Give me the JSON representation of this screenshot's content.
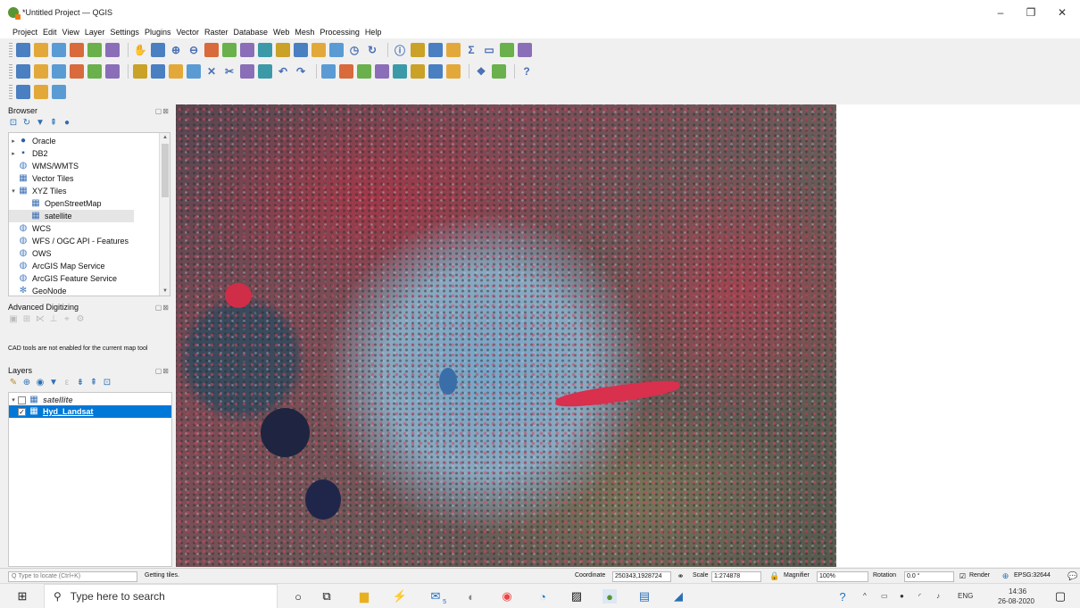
{
  "window": {
    "title": "*Untitled Project — QGIS",
    "controls": [
      "–",
      "❐",
      "✕"
    ]
  },
  "menu": [
    "Project",
    "Edit",
    "View",
    "Layer",
    "Settings",
    "Plugins",
    "Vector",
    "Raster",
    "Database",
    "Web",
    "Mesh",
    "Processing",
    "Help"
  ],
  "toolbars": {
    "row1": [
      "new-project",
      "open-project",
      "save-project",
      "save-as",
      "print-layout",
      "style-manager",
      "|",
      "pan",
      "pan-to-selection",
      "zoom-in",
      "zoom-out",
      "zoom-full",
      "zoom-selection",
      "zoom-layer",
      "zoom-native",
      "zoom-last",
      "zoom-next",
      "new-bookmark",
      "show-bookmarks",
      "temporal-controller",
      "refresh",
      "|",
      "identify",
      "attribute-table",
      "select-features",
      "settings",
      "statistics",
      "measure",
      "map-tips",
      "text-annotation"
    ],
    "row2": [
      "data-source-manager",
      "add-vector",
      "add-raster",
      "digitize",
      "add-postgis",
      "add-delimited",
      "|",
      "edit",
      "save-edits",
      "add-feature",
      "vertex-tool",
      "delete",
      "cut",
      "copy",
      "paste",
      "undo",
      "redo",
      "|",
      "label-tool",
      "pin-label",
      "show-label",
      "highlight-label",
      "move-label",
      "rotate-label",
      "change-label",
      "label-props",
      "|",
      "python",
      "georeferencer",
      "|",
      "help"
    ],
    "row3": [
      "new-layer",
      "group",
      "style"
    ]
  },
  "browser": {
    "title": "Browser",
    "items": [
      {
        "label": "Oracle",
        "level": 0,
        "arrow": "▸",
        "icon": "db"
      },
      {
        "label": "DB2",
        "level": 0,
        "arrow": "▸",
        "icon": "db2"
      },
      {
        "label": "WMS/WMTS",
        "level": 0,
        "arrow": "",
        "icon": "globe"
      },
      {
        "label": "Vector Tiles",
        "level": 0,
        "arrow": "",
        "icon": "grid"
      },
      {
        "label": "XYZ Tiles",
        "level": 0,
        "arrow": "▾",
        "icon": "grid"
      },
      {
        "label": "OpenStreetMap",
        "level": 1,
        "arrow": "",
        "icon": "grid"
      },
      {
        "label": "satellite",
        "level": 1,
        "arrow": "",
        "icon": "grid",
        "selected": true
      },
      {
        "label": "WCS",
        "level": 0,
        "arrow": "",
        "icon": "globe"
      },
      {
        "label": "WFS / OGC API - Features",
        "level": 0,
        "arrow": "",
        "icon": "globe"
      },
      {
        "label": "OWS",
        "level": 0,
        "arrow": "",
        "icon": "globe"
      },
      {
        "label": "ArcGIS Map Service",
        "level": 0,
        "arrow": "",
        "icon": "globe"
      },
      {
        "label": "ArcGIS Feature Service",
        "level": 0,
        "arrow": "",
        "icon": "globe"
      },
      {
        "label": "GeoNode",
        "level": 0,
        "arrow": "",
        "icon": "geonode"
      }
    ]
  },
  "digitizing": {
    "title": "Advanced Digitizing",
    "message": "CAD tools are not enabled for the current map tool"
  },
  "layers": {
    "title": "Layers",
    "items": [
      {
        "label": "satellite",
        "checked": false,
        "arrow": "▾"
      },
      {
        "label": "Hyd_Landsat",
        "checked": true,
        "selected": true,
        "arrow": ""
      }
    ]
  },
  "panel_controls": "▢⊠",
  "status": {
    "locate_placeholder": "Q  Type to locate (Ctrl+K)",
    "message": "Getting tiles.",
    "coordinate_label": "Coordinate",
    "coordinate": "250343,1928724",
    "scale_label": "Scale",
    "scale": "1:274878",
    "magnifier_label": "Magnifier",
    "magnifier": "100%",
    "rotation_label": "Rotation",
    "rotation": "0.0 °",
    "render_label": "Render",
    "crs": "EPSG:32644"
  },
  "taskbar": {
    "search": "Type here to search",
    "lang": "ENG",
    "time": "14:36",
    "date": "26-08-2020",
    "badge": "5"
  },
  "colors": {
    "selection": "#0078d7",
    "qgis_green": "#589632",
    "qgis_orange": "#ee7913"
  }
}
